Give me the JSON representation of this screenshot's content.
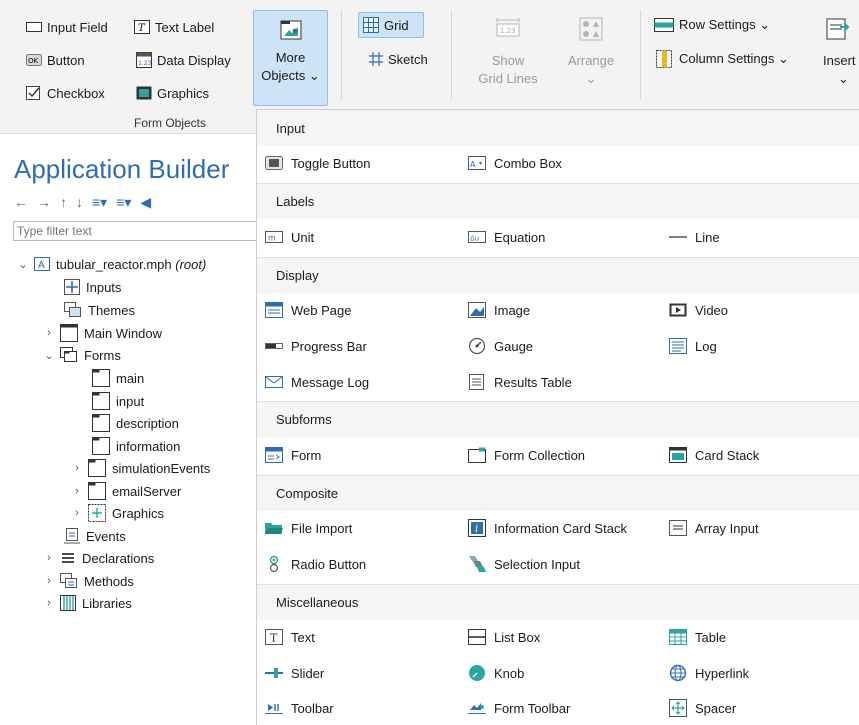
{
  "ribbon": {
    "form_objects": {
      "input_field": "Input Field",
      "text_label": "Text Label",
      "button": "Button",
      "data_display": "Data Display",
      "checkbox": "Checkbox",
      "graphics": "Graphics",
      "group_label": "Form Objects"
    },
    "more_objects": {
      "line1": "More",
      "line2": "Objects ⌄"
    },
    "grid": "Grid",
    "sketch": "Sketch",
    "show_grid_lines": {
      "line1": "Show",
      "line2": "Grid Lines"
    },
    "arrange": {
      "line1": "Arrange",
      "line2": "⌄"
    },
    "row_settings": "Row Settings ⌄",
    "column_settings": "Column Settings ⌄",
    "insert": {
      "line1": "Insert",
      "line2": "⌄"
    }
  },
  "app_builder": {
    "title": "Application Builder",
    "filter_placeholder": "Type filter text",
    "tree": {
      "root": "tubular_reactor.mph",
      "root_suffix": "(root)",
      "inputs": "Inputs",
      "themes": "Themes",
      "main_window": "Main Window",
      "forms": "Forms",
      "forms_children": [
        "main",
        "input",
        "description",
        "information"
      ],
      "simulation_events": "simulationEvents",
      "email_server": "emailServer",
      "graphics": "Graphics",
      "events": "Events",
      "declarations": "Declarations",
      "methods": "Methods",
      "libraries": "Libraries"
    }
  },
  "menu": {
    "sections": {
      "input": "Input",
      "labels": "Labels",
      "display": "Display",
      "subforms": "Subforms",
      "composite": "Composite",
      "misc": "Miscellaneous"
    },
    "items": {
      "toggle_button": "Toggle Button",
      "combo_box": "Combo Box",
      "unit": "Unit",
      "equation": "Equation",
      "line": "Line",
      "web_page": "Web Page",
      "image": "Image",
      "video": "Video",
      "progress_bar": "Progress Bar",
      "gauge": "Gauge",
      "log": "Log",
      "message_log": "Message Log",
      "results_table": "Results Table",
      "form": "Form",
      "form_collection": "Form Collection",
      "card_stack": "Card Stack",
      "file_import": "File Import",
      "information_card_stack": "Information Card Stack",
      "array_input": "Array Input",
      "radio_button": "Radio Button",
      "selection_input": "Selection Input",
      "text": "Text",
      "list_box": "List Box",
      "table": "Table",
      "slider": "Slider",
      "knob": "Knob",
      "hyperlink": "Hyperlink",
      "toolbar": "Toolbar",
      "form_toolbar": "Form Toolbar",
      "spacer": "Spacer"
    }
  },
  "colors": {
    "accent": "#2f6db3",
    "selected_bg": "#cde3f7",
    "selected_border": "#8fbde6"
  }
}
